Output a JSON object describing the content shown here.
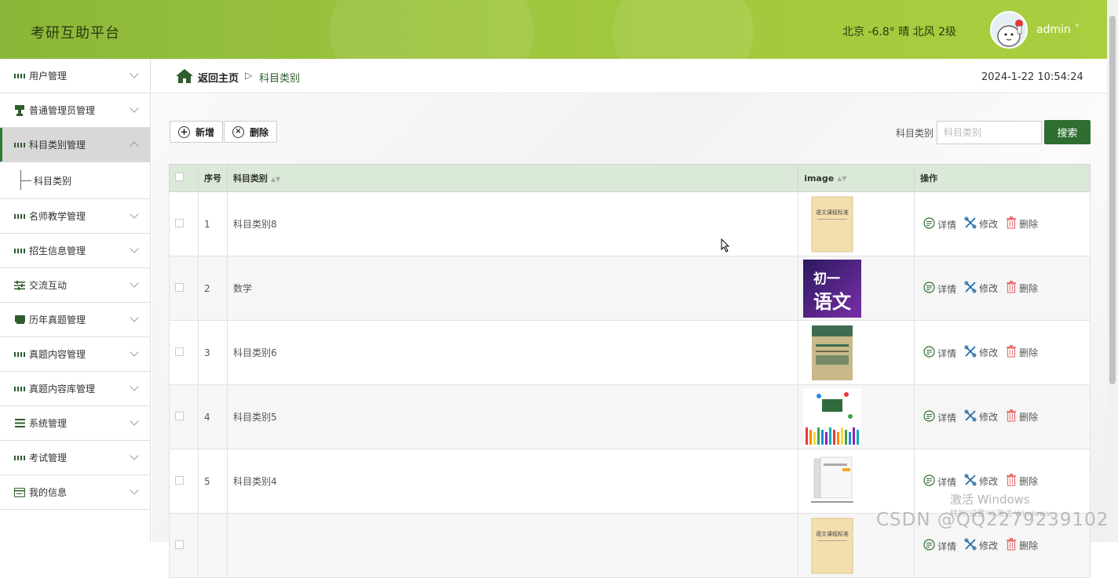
{
  "header": {
    "app_title": "考研互助平台",
    "weather": "北京  -6.8°  晴  北风  2级",
    "username": "admin ˅"
  },
  "sidebar": {
    "items": [
      {
        "label": "用户管理",
        "icon": "grid-icon"
      },
      {
        "label": "普通管理员管理",
        "icon": "stamp-icon"
      },
      {
        "label": "科目类别管理",
        "icon": "grid-icon",
        "open": true,
        "sub": [
          "科目类别"
        ]
      },
      {
        "label": "名师教学管理",
        "icon": "grid-icon"
      },
      {
        "label": "招生信息管理",
        "icon": "grid-icon"
      },
      {
        "label": "交流互动",
        "icon": "sliders-icon"
      },
      {
        "label": "历年真题管理",
        "icon": "book-icon"
      },
      {
        "label": "真题内容管理",
        "icon": "grid-icon"
      },
      {
        "label": "真题内容库管理",
        "icon": "grid-icon"
      },
      {
        "label": "系统管理",
        "icon": "list-icon"
      },
      {
        "label": "考试管理",
        "icon": "grid-icon"
      },
      {
        "label": "我的信息",
        "icon": "card-icon"
      }
    ]
  },
  "breadcrumb": {
    "home": "返回主页",
    "separator": "▷",
    "current": "科目类别"
  },
  "datetime": "2024-1-22 10:54:24",
  "toolbar": {
    "add": "新增",
    "delete": "删除",
    "search_label": "科目类别",
    "search_placeholder": "科目类别",
    "search_button": "搜索"
  },
  "table": {
    "headers": [
      "序号",
      "科目类别",
      "image",
      "操作"
    ],
    "rows": [
      {
        "no": "1",
        "name": "科目类别8",
        "thumb": "book-cover-yellow"
      },
      {
        "no": "2",
        "name": "数学",
        "thumb": "purple-chinese-poster"
      },
      {
        "no": "3",
        "name": "科目类别6",
        "thumb": "book-cover-green"
      },
      {
        "no": "4",
        "name": "科目类别5",
        "thumb": "colorful-hands-illustration"
      },
      {
        "no": "5",
        "name": "科目类别4",
        "thumb": "book-stack-white"
      },
      {
        "no": "",
        "name": "",
        "thumb": "book-cover-yellow"
      }
    ],
    "actions": [
      "详情",
      "修改",
      "删除"
    ]
  },
  "thumb_text": {
    "yellow_book": "语文课程标准",
    "purple_poster_line1": "初一",
    "purple_poster_line2": "语文"
  },
  "watermarks": {
    "windows_line1": "激活 Windows",
    "windows_line2": "转到\"设置\"以激活 Windows。",
    "csdn": "CSDN @QQ2279239102"
  },
  "colors": {
    "header_green": "#9ec63e",
    "accent_dark_green": "#2e6e30",
    "table_header_bg": "#dbe9d8",
    "delete_red": "#e57373"
  }
}
